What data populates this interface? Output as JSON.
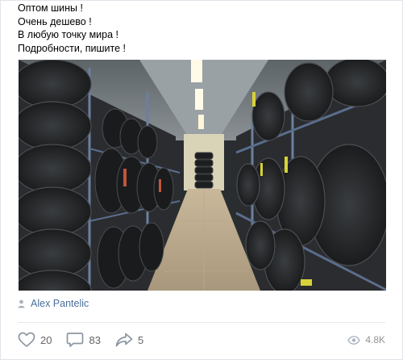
{
  "post": {
    "text_lines": [
      "Оптом шины !",
      "Очень дешево !",
      "В любую точку мира !",
      "Подробности, пишите !"
    ],
    "photo": {
      "subject": "tire-warehouse-photo"
    },
    "author": {
      "name": "Alex Pantelic",
      "icon": "user-icon"
    },
    "actions": {
      "likes": {
        "count": "20",
        "icon": "heart-icon"
      },
      "comments": {
        "count": "83",
        "icon": "comment-icon"
      },
      "shares": {
        "count": "5",
        "icon": "share-icon"
      }
    },
    "views": {
      "count": "4.8K",
      "icon": "eye-icon"
    }
  },
  "colors": {
    "link": "#4a6f9a",
    "meta": "#939393",
    "action_text": "#656565",
    "divider": "#e7e8ec"
  }
}
